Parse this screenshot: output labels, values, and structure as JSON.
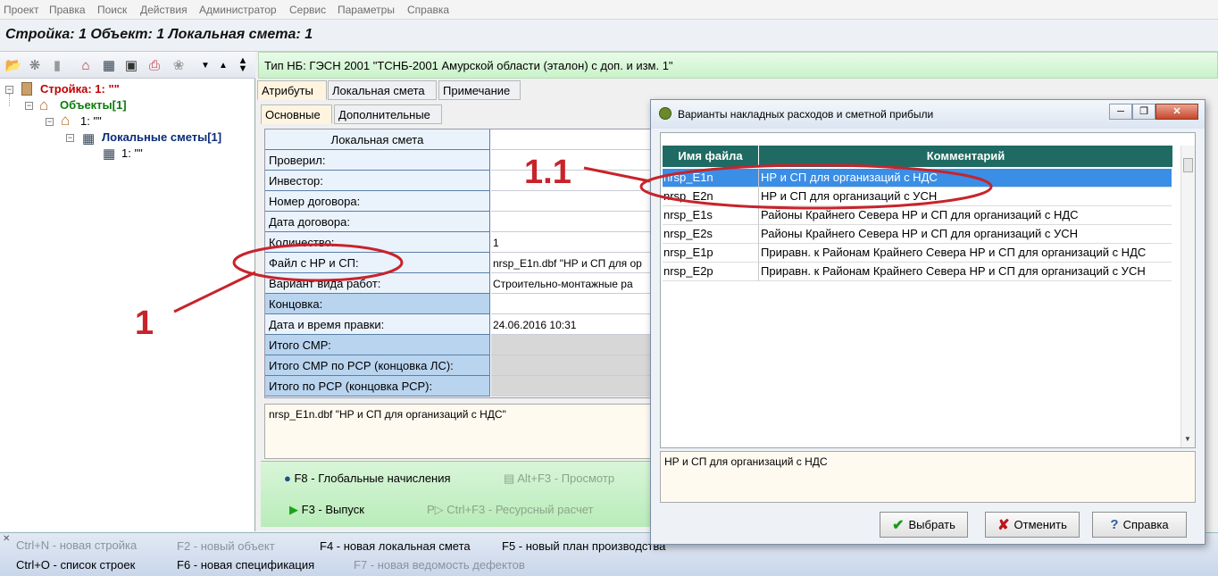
{
  "menu": [
    "Проект",
    "Правка",
    "Поиск",
    "Действия",
    "Администратор",
    "Сервис",
    "Параметры",
    "Справка"
  ],
  "title_strip": "Стройка: 1  Объект: 1  Локальная смета: 1",
  "tree": {
    "root": "Стройка: 1: \"\"",
    "objects": "Объекты[1]",
    "object1": "1: \"\"",
    "estimates": "Локальные сметы[1]",
    "estimate1": "1: \"\""
  },
  "info_bar": "Тип НБ: ГЭСН 2001 \"ТСНБ-2001 Амурской области (эталон) с доп. и изм. 1\"",
  "tabs_top": [
    "Атрибуты",
    "Локальная смета",
    "Примечание"
  ],
  "tabs_sub": [
    "Основные",
    "Дополнительные"
  ],
  "form": {
    "header_label": "Локальная смета",
    "rows": [
      {
        "label": "Проверил:",
        "value": ""
      },
      {
        "label": "Инвестор:",
        "value": ""
      },
      {
        "label": "Номер договора:",
        "value": ""
      },
      {
        "label": "Дата договора:",
        "value": ""
      },
      {
        "label": "Количество:",
        "value": "1"
      },
      {
        "label": "Файл с НР и СП:",
        "value": "nrsp_E1n.dbf  \"НР и СП для ор"
      },
      {
        "label": "Вариант вида работ:",
        "value": "Строительно-монтажные ра"
      },
      {
        "label": "Концовка:",
        "value": ""
      },
      {
        "label": "Дата и время правки:",
        "value": "24.06.2016  10:31"
      },
      {
        "label": "Итого СМР:",
        "value": ""
      },
      {
        "label": "Итого СМР по РСР (концовка ЛС):",
        "value": ""
      },
      {
        "label": "Итого по РСР (концовка РСР):",
        "value": ""
      }
    ]
  },
  "note": "nrsp_E1n.dbf  \"НР и СП для организаций с НДС\"",
  "green_buttons": {
    "global": "F8 - Глобальные начисления",
    "preview": "Alt+F3 - Просмотр",
    "issue": "F3 - Выпуск",
    "resource": "Ctrl+F3 - Ресурсный расчет"
  },
  "status": {
    "new_build": "Ctrl+N - новая стройка",
    "new_object": "F2 - новый объект",
    "new_local": "F4 - новая локальная смета",
    "new_plan": "F5 - новый план производства",
    "list_builds": "Ctrl+O - список строек",
    "new_spec": "F6 - новая спецификация",
    "new_defects": "F7 - новая ведомость дефектов"
  },
  "dialog": {
    "title": "Варианты накладных расходов и сметной прибыли",
    "col_file": "Имя файла",
    "col_comment": "Комментарий",
    "rows": [
      {
        "file": "nrsp_E1n",
        "comment": "НР и СП для организаций с НДС"
      },
      {
        "file": "nrsp_E2n",
        "comment": "НР и СП для организаций с УСН"
      },
      {
        "file": "nrsp_E1s",
        "comment": "Районы Крайнего Севера НР и СП для организаций с НДС"
      },
      {
        "file": "nrsp_E2s",
        "comment": "Районы Крайнего Севера НР и СП для организаций с УСН"
      },
      {
        "file": "nrsp_E1p",
        "comment": "Приравн. к Районам Крайнего Севера НР и СП для организаций с НДС"
      },
      {
        "file": "nrsp_E2p",
        "comment": "Приравн. к Районам Крайнего Севера НР и СП для организаций с УСН"
      }
    ],
    "memo": "НР и СП для организаций с НДС",
    "btn_select": "Выбрать",
    "btn_cancel": "Отменить",
    "btn_help": "Справка"
  },
  "annotations": {
    "one": "1",
    "one_one": "1.1"
  },
  "colors": {
    "annotation": "#c8232b",
    "selection": "#3a8ee6",
    "grid_header": "#1f6b63"
  }
}
